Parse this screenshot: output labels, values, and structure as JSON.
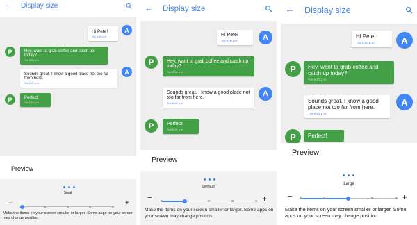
{
  "screens": [
    {
      "size_key": "small",
      "back_icon": "arrow-back-icon",
      "search_icon": "search-icon",
      "title": "Display size",
      "messages": [
        {
          "text": "Hi Pete!",
          "time": "Tue 6:00 p.m.",
          "sender": "A"
        },
        {
          "text": "Hey, want to grab coffee and catch up today?",
          "time": "Tue 6:00 p.m.",
          "sender": "P"
        },
        {
          "text": "Sounds great. I know a good place not too far from here.",
          "time": "Tue 6:02 p.m.",
          "sender": "A"
        },
        {
          "text": "Perfect!",
          "time": "Tue 6:02 p.m.",
          "sender": "P"
        }
      ],
      "preview_label": "Preview",
      "size_label": "Small",
      "minus": "−",
      "plus": "+",
      "slider_level": 0,
      "slider_steps": 5,
      "description": "Make the items on your screen smaller or larger. Some apps on your screen may change position."
    },
    {
      "size_key": "default",
      "back_icon": "arrow-back-icon",
      "search_icon": "search-icon",
      "title": "Display size",
      "messages": [
        {
          "text": "Hi Pete!",
          "time": "Tue 6:00 p.m.",
          "sender": "A"
        },
        {
          "text": "Hey, want to grab coffee and catch up today?",
          "time": "Tue 6:00 p.m.",
          "sender": "P"
        },
        {
          "text": "Sounds great. I know a good place not too far from here.",
          "time": "Tue 6:00 p.m.",
          "sender": "A"
        },
        {
          "text": "Perfect!",
          "time": "Tue 6:02 p.m.",
          "sender": "P"
        }
      ],
      "preview_label": "Preview",
      "size_label": "Default",
      "minus": "−",
      "plus": "+",
      "slider_level": 1,
      "slider_steps": 5,
      "description": "Make the items on your screen smaller or larger. Some apps on your screen may change position."
    },
    {
      "size_key": "large",
      "back_icon": "arrow-back-icon",
      "search_icon": "search-icon",
      "title": "Display size",
      "messages": [
        {
          "text": "Hi Pete!",
          "time": "Tue 6:00 p.m.",
          "sender": "A"
        },
        {
          "text": "Hey, want to grab coffee and catch up today?",
          "time": "Tue 6:00 p.m.",
          "sender": "P"
        },
        {
          "text": "Sounds great. I know a good place not too far from here.",
          "time": "Tue 6:02 p.m.",
          "sender": "A"
        },
        {
          "text": "Perfect!",
          "time": "",
          "sender": "P"
        }
      ],
      "preview_label": "Preview",
      "size_label": "Large",
      "minus": "−",
      "plus": "+",
      "slider_level": 2,
      "slider_steps": 5,
      "description": "Make the items on your screen smaller or larger. Some apps on your screen may change position."
    }
  ],
  "colors": {
    "accent": "#4285f4",
    "outgoing_bubble": "#43a047",
    "chat_background": "#eeeeee",
    "controls_background": "#f2f2f2"
  }
}
